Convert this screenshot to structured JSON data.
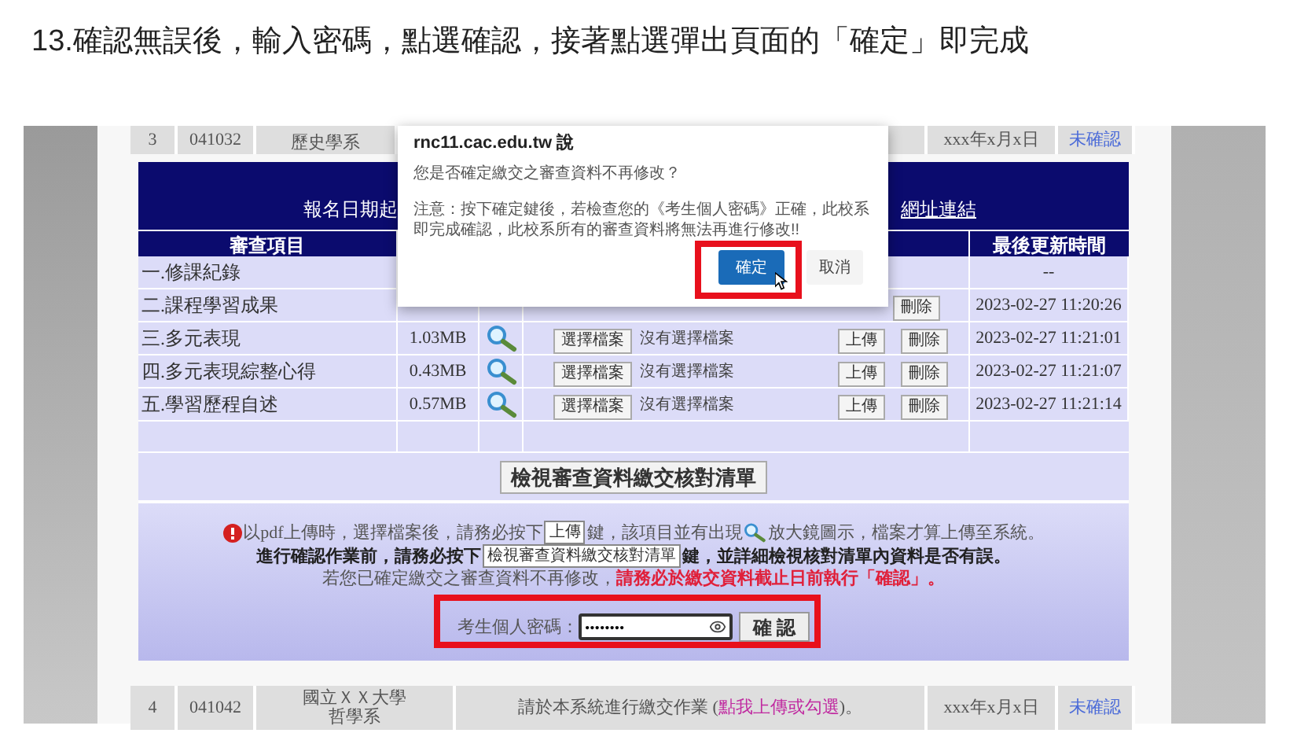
{
  "heading": "13.確認無誤後，輸入密碼，點選確認，接著點選彈出頁面的「確定」即完成",
  "prev_row": {
    "no": "3",
    "code": "041032",
    "dept": "歷史學系",
    "date": "xxx年x月x日",
    "status": "未確認"
  },
  "banner": {
    "text": "報名日期起",
    "link": "網址連結"
  },
  "columns": [
    "審查項目",
    "最後更新時間"
  ],
  "items": [
    {
      "kind": "empty",
      "name": "一.修課紀錄",
      "time": "--"
    },
    {
      "kind": "partial",
      "name": "二.課程學習成果",
      "delete": "刪除",
      "time": "2023-02-27 11:20:26"
    },
    {
      "kind": "file",
      "name": "三.多元表現",
      "size": "1.03MB",
      "choose": "選擇檔案",
      "no_file": "沒有選擇檔案",
      "upload": "上傳",
      "delete": "刪除",
      "time": "2023-02-27 11:21:01"
    },
    {
      "kind": "file",
      "name": "四.多元表現綜整心得",
      "size": "0.43MB",
      "choose": "選擇檔案",
      "no_file": "沒有選擇檔案",
      "upload": "上傳",
      "delete": "刪除",
      "time": "2023-02-27 11:21:07"
    },
    {
      "kind": "file",
      "name": "五.學習歷程自述",
      "size": "0.57MB",
      "choose": "選擇檔案",
      "no_file": "沒有選擇檔案",
      "upload": "上傳",
      "delete": "刪除",
      "time": "2023-02-27 11:21:14"
    },
    {
      "kind": "blank"
    }
  ],
  "checklist_button": "檢視審查資料繳交核對清單",
  "notice": [
    {
      "kind": "plain",
      "segments": [
        {
          "kind": "alert"
        },
        {
          "kind": "text",
          "text": "以pdf上傳時，選擇檔案後，請務必按下"
        },
        {
          "kind": "key",
          "text": "上傳"
        },
        {
          "kind": "text",
          "text": "鍵，該項目並有出現"
        },
        {
          "kind": "icon"
        },
        {
          "kind": "text",
          "text": "放大鏡圖示，檔案才算上傳至系統。"
        }
      ]
    },
    {
      "kind": "emphasis",
      "segments": [
        {
          "kind": "text",
          "text": "進行確認作業前，請務必按下"
        },
        {
          "kind": "key",
          "text": "檢視審查資料繳交核對清單"
        },
        {
          "kind": "text",
          "text": "鍵，並詳細檢視核對清單內資料是否有誤。"
        }
      ]
    },
    {
      "kind": "plain",
      "segments": [
        {
          "kind": "text",
          "text": "若您已確定繳交之審查資料不再修改，"
        },
        {
          "kind": "warning",
          "text": "請務必於繳交資料截止日前執行「確認」。"
        }
      ]
    }
  ],
  "password": {
    "label": "考生個人密碼：",
    "value": "••••••••",
    "button": "確 認"
  },
  "next_row": {
    "no": "4",
    "code": "041042",
    "dept": [
      "國立ＸＸ大學",
      "哲學系"
    ],
    "message": "請於本系統進行繳交作業 (",
    "link": "點我上傳或勾選",
    "message_end": ")。",
    "date": "xxx年x月x日",
    "status": "未確認"
  },
  "dialog": {
    "origin": "rnc11.cac.edu.tw 說",
    "question": "您是否確定繳交之審查資料不再修改？",
    "note": "注意：按下確定鍵後，若檢查您的《考生個人密碼》正確，此校系即完成確認，此校系所有的審查資料將無法再進行修改!!",
    "ok": "確定",
    "cancel": "取消"
  }
}
